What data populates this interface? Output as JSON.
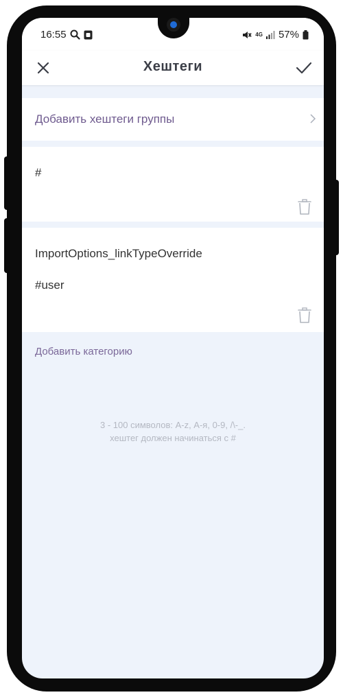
{
  "statusbar": {
    "time": "16:55",
    "network": "4G",
    "battery": "57%"
  },
  "header": {
    "title": "Хештеги"
  },
  "group_row": {
    "label": "Добавить хештеги группы"
  },
  "cards": [
    {
      "name": "",
      "hashtag": "#"
    },
    {
      "name": "ImportOptions_linkTypeOverride",
      "hashtag": "#user"
    }
  ],
  "add_category": "Добавить категорию",
  "hint": {
    "line1": "3 - 100 символов: A-z, А-я, 0-9, /\\-_.",
    "line2": "хештег должен начинаться с #"
  },
  "colors": {
    "accent": "#6e5a8e",
    "background": "#eef3fb",
    "frame": "#0b0b0b"
  },
  "icons": [
    "search-icon",
    "gallery-icon",
    "mute-icon",
    "signal-icon",
    "battery-icon",
    "close-icon",
    "check-icon",
    "chevron-right-icon",
    "trash-icon"
  ]
}
